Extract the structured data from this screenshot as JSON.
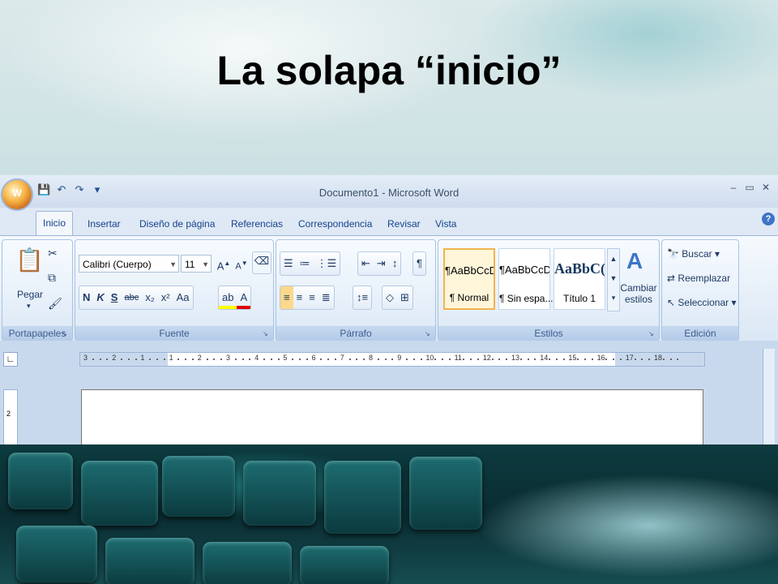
{
  "slide": {
    "title": "La solapa “inicio”"
  },
  "window": {
    "title": "Documento1 - Microsoft Word",
    "office_button": "W",
    "controls": [
      "–",
      "▭",
      "✕"
    ]
  },
  "tabs": [
    {
      "label": "Inicio",
      "active": true
    },
    {
      "label": "Insertar"
    },
    {
      "label": "Diseño de página"
    },
    {
      "label": "Referencias"
    },
    {
      "label": "Correspondencia"
    },
    {
      "label": "Revisar"
    },
    {
      "label": "Vista"
    }
  ],
  "groups": {
    "portapapeles": {
      "label": "Portapapeles",
      "paste": "Pegar"
    },
    "fuente": {
      "label": "Fuente",
      "font": "Calibri (Cuerpo)",
      "size": "11",
      "buttons": [
        "N",
        "K",
        "S",
        "abc",
        "x₂",
        "x²",
        "Aa"
      ]
    },
    "parrafo": {
      "label": "Párrafo"
    },
    "estilos": {
      "label": "Estilos",
      "styles": [
        {
          "sample": "¶AaBbCcDc",
          "name": "¶ Normal"
        },
        {
          "sample": "¶AaBbCcDc",
          "name": "¶ Sin espa..."
        },
        {
          "sample": "AaBbC(",
          "name": "Título 1"
        }
      ],
      "change": "Cambiar estilos"
    },
    "edicion": {
      "label": "Edición",
      "find": "Buscar",
      "replace": "Reemplazar",
      "select": "Seleccionar"
    }
  },
  "ruler": {
    "numbers": [
      "3",
      "2",
      "1",
      "1",
      "2",
      "3",
      "4",
      "5",
      "6",
      "7",
      "8",
      "9",
      "10",
      "11",
      "12",
      "13",
      "14",
      "15",
      "16",
      "17",
      "18"
    ]
  },
  "colors": {
    "accent": "#15428b",
    "ribbon": "#dbe7f5",
    "highlight": "#f1b34d"
  },
  "vertical_ruler": "2"
}
